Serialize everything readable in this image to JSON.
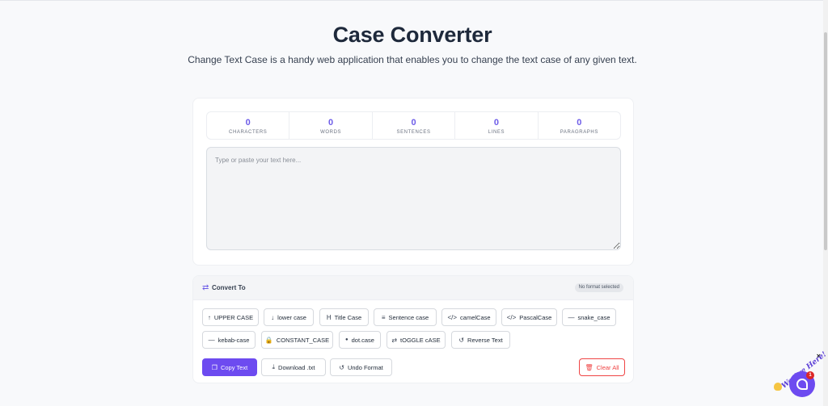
{
  "header": {
    "title": "Case Converter",
    "subtitle": "Change Text Case is a handy web application that enables you to change the text case of any given text."
  },
  "stats": [
    {
      "value": "0",
      "label": "CHARACTERS"
    },
    {
      "value": "0",
      "label": "WORDS"
    },
    {
      "value": "0",
      "label": "SENTENCES"
    },
    {
      "value": "0",
      "label": "LINES"
    },
    {
      "value": "0",
      "label": "PARAGRAPHS"
    }
  ],
  "editor": {
    "value": "",
    "placeholder": "Type or paste your text here..."
  },
  "convert": {
    "title": "Convert To",
    "status": "No format selected",
    "buttons": [
      {
        "label": "UPPER CASE",
        "icon": "arrow-up-icon",
        "glyph": "↑"
      },
      {
        "label": "lower case",
        "icon": "arrow-down-icon",
        "glyph": "↓"
      },
      {
        "label": "Title Case",
        "icon": "heading-icon",
        "glyph": "H"
      },
      {
        "label": "Sentence case",
        "icon": "align-left-icon",
        "glyph": "≡"
      },
      {
        "label": "camelCase",
        "icon": "code-icon",
        "glyph": "</>"
      },
      {
        "label": "PascalCase",
        "icon": "code-icon",
        "glyph": "</>"
      },
      {
        "label": "snake_case",
        "icon": "minus-icon",
        "glyph": "—"
      },
      {
        "label": "kebab-case",
        "icon": "minus-icon",
        "glyph": "—"
      },
      {
        "label": "CONSTANT_CASE",
        "icon": "lock-icon",
        "glyph": "🔒"
      },
      {
        "label": "dot.case",
        "icon": "dot-icon",
        "glyph": "●"
      },
      {
        "label": "tOGGLE cASE",
        "icon": "swap-icon",
        "glyph": "⇄"
      },
      {
        "label": "Reverse Text",
        "icon": "undo-icon",
        "glyph": "↺"
      }
    ]
  },
  "actions": {
    "copy": {
      "label": "Copy Text",
      "glyph": "❐"
    },
    "download": {
      "label": "Download .txt",
      "glyph": "⤓"
    },
    "undo": {
      "label": "Undo Format",
      "glyph": "↺"
    },
    "clear": {
      "label": "Clear All",
      "glyph": "🗑"
    }
  },
  "widget": {
    "script": "We Are Here!",
    "badge_count": "1",
    "close": "×"
  },
  "colors": {
    "accent": "#6d4bf0",
    "danger": "#ef4444",
    "stat_value": "#6d5ce8"
  }
}
